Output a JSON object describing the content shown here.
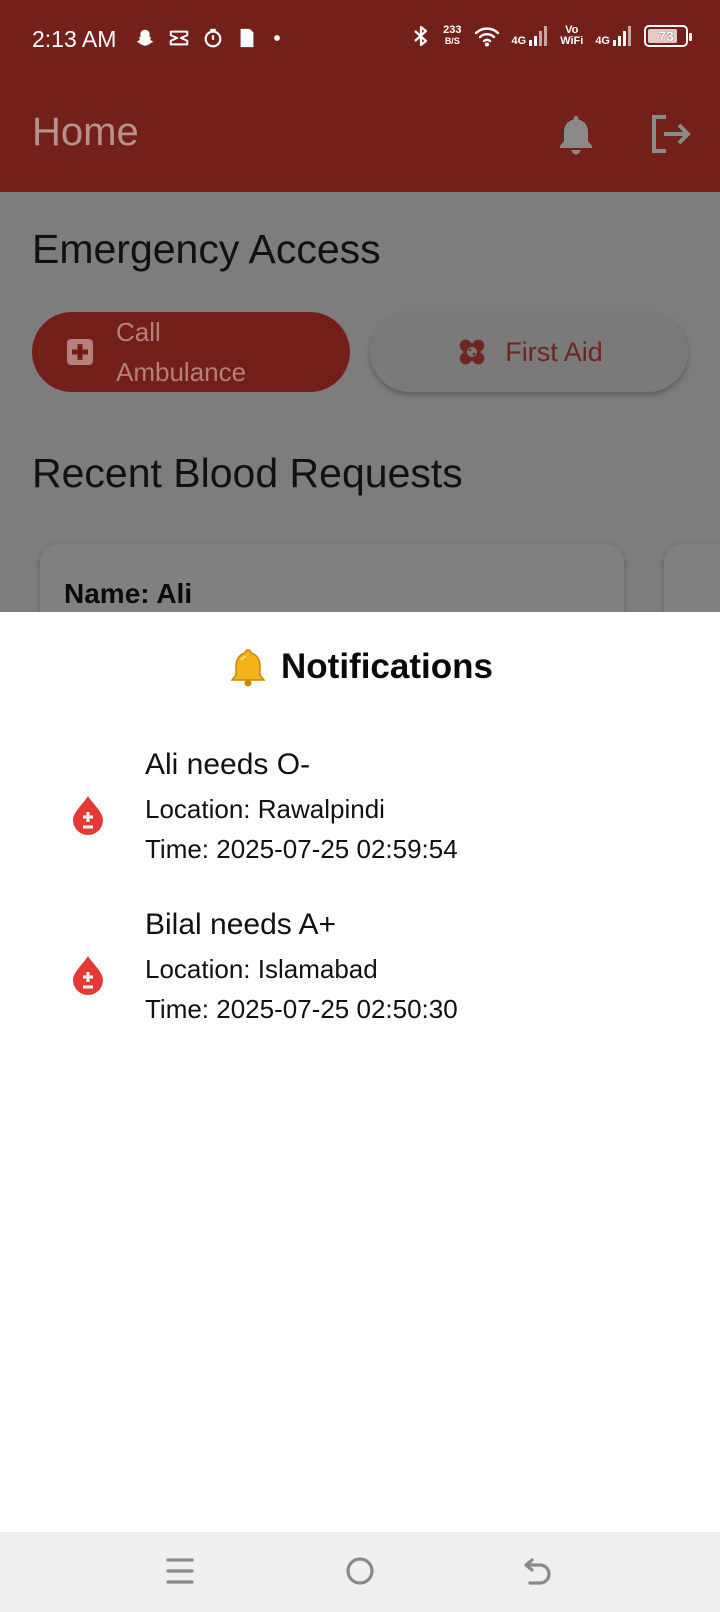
{
  "status_bar": {
    "time": "2:13 AM",
    "left_icons": [
      "snapchat-icon",
      "capcut-icon",
      "timer-icon",
      "file-icon",
      "dot-icon"
    ],
    "net_speed_value": "233",
    "net_speed_unit": "B/S",
    "signal1_label": "4G",
    "vowifi_label_top": "Vo",
    "vowifi_label_bottom": "WiFi",
    "signal2_label": "4G",
    "battery_level": "73"
  },
  "app_bar": {
    "title": "Home",
    "actions": [
      "bell-icon",
      "logout-icon"
    ]
  },
  "main": {
    "emergency_title": "Emergency Access",
    "ambulance_label": "Call Ambulance",
    "first_aid_label": "First Aid",
    "recent_title": "Recent Blood Requests",
    "card_name": "Name: Ali"
  },
  "sheet": {
    "title_emoji": "🔔",
    "title": "Notifications",
    "items": [
      {
        "title": "Ali needs O-",
        "location": "Location: Rawalpindi",
        "time": "Time: 2025-07-25 02:59:54"
      },
      {
        "title": "Bilal needs A+",
        "location": "Location: Islamabad",
        "time": "Time: 2025-07-25 02:50:30"
      }
    ]
  },
  "nav_bar": {
    "buttons": [
      "menu-icon",
      "home-circle-icon",
      "back-icon"
    ]
  },
  "colors": {
    "app_bar": "#73201b",
    "scrim": "#7d7d7d",
    "accent_red": "#e53935",
    "nav_bar": "#efefef"
  }
}
